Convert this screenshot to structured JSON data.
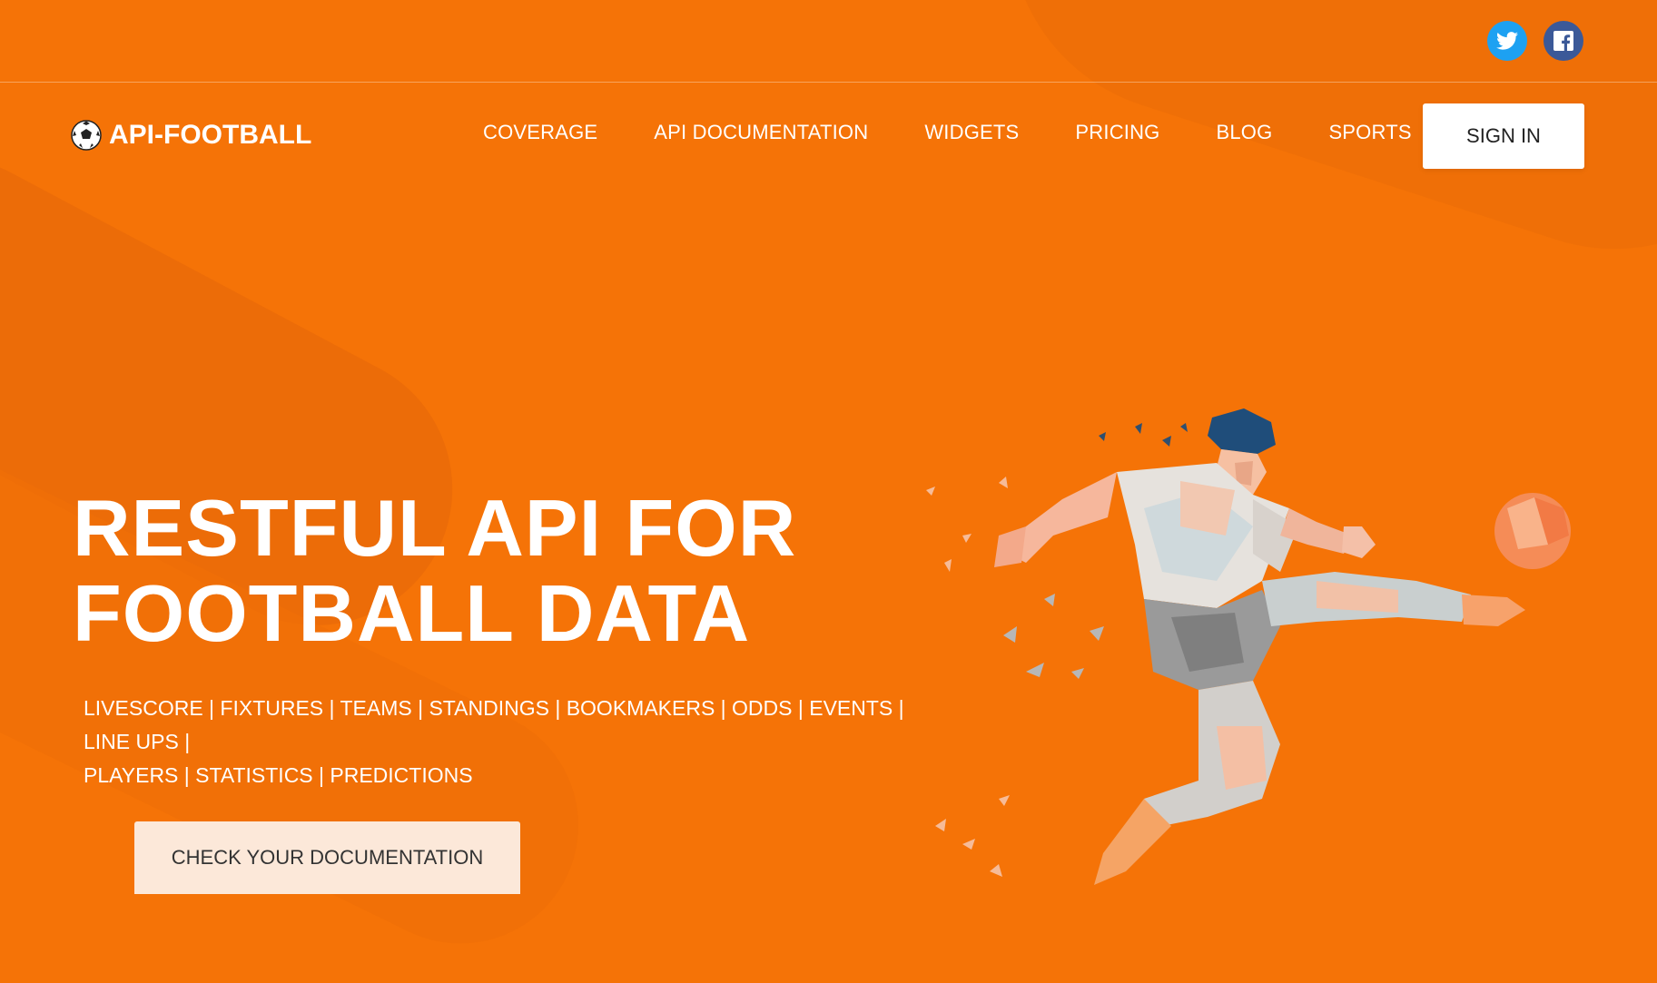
{
  "social": {
    "twitter_icon": "twitter-icon",
    "facebook_icon": "facebook-icon",
    "twitter_color": "#1da1f2",
    "facebook_color": "#3b5998"
  },
  "header": {
    "logo_text": "API-FOOTBALL",
    "logo_icon": "soccer-ball-icon",
    "nav": [
      {
        "label": "COVERAGE"
      },
      {
        "label": "API DOCUMENTATION"
      },
      {
        "label": "WIDGETS"
      },
      {
        "label": "PRICING"
      },
      {
        "label": "BLOG"
      },
      {
        "label": "SPORTS"
      }
    ],
    "signin_label": "SIGN IN"
  },
  "hero": {
    "title_line1": "RESTFUL API FOR",
    "title_line2": "FOOTBALL DATA",
    "subtitle_line1": "LIVESCORE | FIXTURES | TEAMS | STANDINGS | BOOKMAKERS | ODDS | EVENTS | LINE UPS |",
    "subtitle_line2": "PLAYERS | STATISTICS | PREDICTIONS",
    "cta_label": "CHECK YOUR DOCUMENTATION",
    "illustration": "low-poly-football-player-illustration"
  },
  "colors": {
    "background": "#f57307",
    "accent_light": "#fce8d9",
    "text": "#ffffff"
  }
}
